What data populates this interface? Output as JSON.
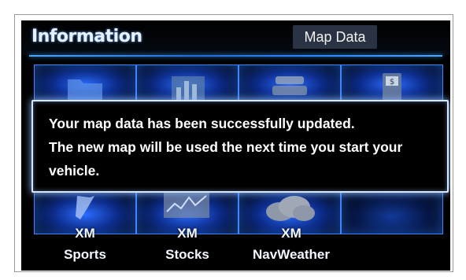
{
  "header": {
    "title": "Information",
    "tab_map_data": "Map Data"
  },
  "dialog": {
    "line1": "Your map data has been successfully updated.",
    "line2": "The new map will be used the next time you start your",
    "line3": "vehicle."
  },
  "tiles": {
    "sports": {
      "line1": "XM",
      "line2": "Sports",
      "icon": "sports-icon"
    },
    "stocks": {
      "line1": "XM",
      "line2": "Stocks",
      "icon": "stocks-icon"
    },
    "navweather": {
      "line1": "XM",
      "line2": "NavWeather",
      "icon": "weather-icon"
    }
  },
  "colors": {
    "accent": "#3d86ff",
    "background": "#000000",
    "text": "#ffffff"
  }
}
